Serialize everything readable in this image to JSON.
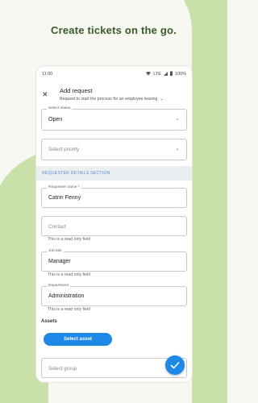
{
  "tagline": "Create tickets on the go.",
  "statusbar": {
    "time": "11:00",
    "network": "LTE",
    "battery": "100%"
  },
  "appbar": {
    "title": "Add request",
    "subtitle": "Request to start the process for an employee leaving"
  },
  "form": {
    "status": {
      "label": "Select status",
      "value": "Open"
    },
    "priority": {
      "placeholder": "Select priority"
    },
    "section_header": "REQUESTER DETAILS SECTION",
    "requester": {
      "label": "Requester name *",
      "value": "Catrin Fenny"
    },
    "contact": {
      "placeholder": "Contact",
      "helper": "This is a read only field"
    },
    "job_title": {
      "label": "Job title",
      "value": "Manager",
      "helper": "This is a read only field"
    },
    "department": {
      "label": "Department",
      "value": "Administration",
      "helper": "This is a read only field"
    },
    "assets_label": "Assets",
    "select_asset_button": "Select asset",
    "group": {
      "placeholder": "Select group"
    }
  },
  "colors": {
    "accent": "#1d88e5",
    "background_green": "#c9e0a8",
    "tagline": "#3a5a2a"
  },
  "icons": {
    "close": "close-icon",
    "submit": "check-icon",
    "dropdown": "chevron-down-icon"
  }
}
